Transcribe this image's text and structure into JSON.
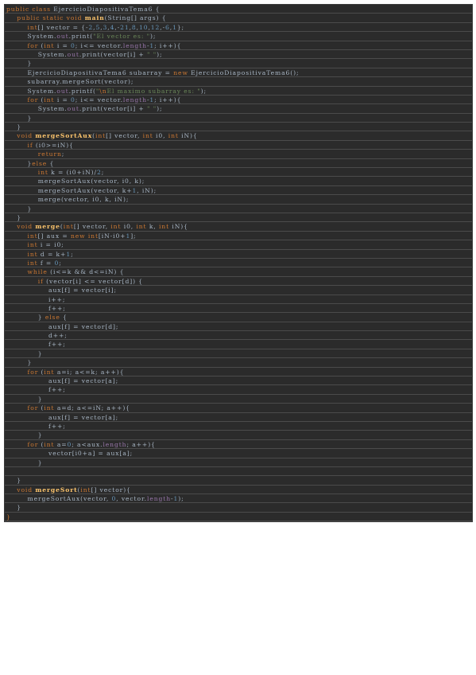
{
  "document": {
    "language": "java",
    "colors": {
      "background": "#2b2b2b",
      "keyword": "#cc7832",
      "method": "#ffc66d",
      "number": "#6897bb",
      "string": "#6a8759",
      "field": "#9876aa",
      "text": "#a9b7c6"
    },
    "lines": [
      [
        {
          "t": "kw",
          "v": "public class "
        },
        {
          "t": "tx",
          "v": "EjercicioDiapositivaTema6 {"
        }
      ],
      [
        {
          "t": "tx",
          "v": "    "
        },
        {
          "t": "kw",
          "v": "public static void "
        },
        {
          "t": "fn",
          "v": "main"
        },
        {
          "t": "tx",
          "v": "(String[] args) {"
        }
      ],
      [
        {
          "t": "tx",
          "v": "        "
        },
        {
          "t": "kw",
          "v": "int"
        },
        {
          "t": "tx",
          "v": "[] vector = {-"
        },
        {
          "t": "num",
          "v": "2"
        },
        {
          "t": "tx",
          "v": ","
        },
        {
          "t": "num",
          "v": "5"
        },
        {
          "t": "tx",
          "v": ","
        },
        {
          "t": "num",
          "v": "3"
        },
        {
          "t": "tx",
          "v": ","
        },
        {
          "t": "num",
          "v": "4"
        },
        {
          "t": "tx",
          "v": ",-"
        },
        {
          "t": "num",
          "v": "21"
        },
        {
          "t": "tx",
          "v": ","
        },
        {
          "t": "num",
          "v": "8"
        },
        {
          "t": "tx",
          "v": ","
        },
        {
          "t": "num",
          "v": "10"
        },
        {
          "t": "tx",
          "v": ","
        },
        {
          "t": "num",
          "v": "12"
        },
        {
          "t": "tx",
          "v": ",-"
        },
        {
          "t": "num",
          "v": "6"
        },
        {
          "t": "tx",
          "v": ","
        },
        {
          "t": "num",
          "v": "1"
        },
        {
          "t": "tx",
          "v": "};"
        }
      ],
      [
        {
          "t": "tx",
          "v": "        System."
        },
        {
          "t": "fld",
          "v": "out"
        },
        {
          "t": "tx",
          "v": ".print("
        },
        {
          "t": "str",
          "v": "\"El vector es: \""
        },
        {
          "t": "tx",
          "v": ");"
        }
      ],
      [
        {
          "t": "tx",
          "v": "        "
        },
        {
          "t": "kw",
          "v": "for "
        },
        {
          "t": "tx",
          "v": "("
        },
        {
          "t": "kw",
          "v": "int "
        },
        {
          "t": "tx",
          "v": "i = "
        },
        {
          "t": "num",
          "v": "0"
        },
        {
          "t": "tx",
          "v": "; i<= vector."
        },
        {
          "t": "fld",
          "v": "length"
        },
        {
          "t": "tx",
          "v": "-"
        },
        {
          "t": "num",
          "v": "1"
        },
        {
          "t": "tx",
          "v": "; i++){"
        }
      ],
      [
        {
          "t": "tx",
          "v": "            System."
        },
        {
          "t": "fld",
          "v": "out"
        },
        {
          "t": "tx",
          "v": ".print(vector[i] + "
        },
        {
          "t": "str",
          "v": "\" \""
        },
        {
          "t": "tx",
          "v": ");"
        }
      ],
      [
        {
          "t": "tx",
          "v": "        }"
        }
      ],
      [
        {
          "t": "tx",
          "v": "        EjercicioDiapositivaTema6 subarray = "
        },
        {
          "t": "kw",
          "v": "new "
        },
        {
          "t": "tx",
          "v": "EjercicioDiapositivaTema6();"
        }
      ],
      [
        {
          "t": "tx",
          "v": "        subarray.mergeSort(vector);"
        }
      ],
      [
        {
          "t": "tx",
          "v": "        System."
        },
        {
          "t": "fld",
          "v": "out"
        },
        {
          "t": "tx",
          "v": ".printf("
        },
        {
          "t": "str",
          "v": "\""
        },
        {
          "t": "esc",
          "v": "\\n"
        },
        {
          "t": "str",
          "v": "El maximo subarray es: \""
        },
        {
          "t": "tx",
          "v": ");"
        }
      ],
      [
        {
          "t": "tx",
          "v": "        "
        },
        {
          "t": "kw",
          "v": "for "
        },
        {
          "t": "tx",
          "v": "("
        },
        {
          "t": "kw",
          "v": "int "
        },
        {
          "t": "tx",
          "v": "i = "
        },
        {
          "t": "num",
          "v": "0"
        },
        {
          "t": "tx",
          "v": "; i<= vector."
        },
        {
          "t": "fld",
          "v": "length"
        },
        {
          "t": "tx",
          "v": "-"
        },
        {
          "t": "num",
          "v": "1"
        },
        {
          "t": "tx",
          "v": "; i++){"
        }
      ],
      [
        {
          "t": "tx",
          "v": "            System."
        },
        {
          "t": "fld",
          "v": "out"
        },
        {
          "t": "tx",
          "v": ".print(vector[i] + "
        },
        {
          "t": "str",
          "v": "\" \""
        },
        {
          "t": "tx",
          "v": ");"
        }
      ],
      [
        {
          "t": "tx",
          "v": "        }"
        }
      ],
      [
        {
          "t": "tx",
          "v": "    }"
        }
      ],
      [
        {
          "t": "tx",
          "v": "    "
        },
        {
          "t": "kw",
          "v": "void "
        },
        {
          "t": "fn",
          "v": "mergeSortAux"
        },
        {
          "t": "tx",
          "v": "("
        },
        {
          "t": "kw",
          "v": "int"
        },
        {
          "t": "tx",
          "v": "[] vector, "
        },
        {
          "t": "kw",
          "v": "int "
        },
        {
          "t": "tx",
          "v": "i0, "
        },
        {
          "t": "kw",
          "v": "int "
        },
        {
          "t": "tx",
          "v": "iN){"
        }
      ],
      [
        {
          "t": "tx",
          "v": "        "
        },
        {
          "t": "kw",
          "v": "if "
        },
        {
          "t": "tx",
          "v": "(i0>=iN){"
        }
      ],
      [
        {
          "t": "tx",
          "v": "            "
        },
        {
          "t": "kw",
          "v": "return"
        },
        {
          "t": "tx",
          "v": ";"
        }
      ],
      [
        {
          "t": "tx",
          "v": "        }"
        },
        {
          "t": "kw",
          "v": "else "
        },
        {
          "t": "tx",
          "v": "{"
        }
      ],
      [
        {
          "t": "tx",
          "v": "            "
        },
        {
          "t": "kw",
          "v": "int "
        },
        {
          "t": "tx",
          "v": "k = (i0+iN)/"
        },
        {
          "t": "num",
          "v": "2"
        },
        {
          "t": "tx",
          "v": ";"
        }
      ],
      [
        {
          "t": "tx",
          "v": "            mergeSortAux(vector, i0, k);"
        }
      ],
      [
        {
          "t": "tx",
          "v": "            mergeSortAux(vector, k+"
        },
        {
          "t": "num",
          "v": "1"
        },
        {
          "t": "tx",
          "v": ", iN);"
        }
      ],
      [
        {
          "t": "tx",
          "v": "            merge(vector, i0, k, iN);"
        }
      ],
      [
        {
          "t": "tx",
          "v": "        }"
        }
      ],
      [
        {
          "t": "tx",
          "v": "    }"
        }
      ],
      [
        {
          "t": "tx",
          "v": "    "
        },
        {
          "t": "kw",
          "v": "void "
        },
        {
          "t": "fn",
          "v": "merge"
        },
        {
          "t": "tx",
          "v": "("
        },
        {
          "t": "kw",
          "v": "int"
        },
        {
          "t": "tx",
          "v": "[] vector, "
        },
        {
          "t": "kw",
          "v": "int "
        },
        {
          "t": "tx",
          "v": "i0, "
        },
        {
          "t": "kw",
          "v": "int "
        },
        {
          "t": "tx",
          "v": "k, "
        },
        {
          "t": "kw",
          "v": "int "
        },
        {
          "t": "tx",
          "v": "iN){"
        }
      ],
      [
        {
          "t": "tx",
          "v": "        "
        },
        {
          "t": "kw",
          "v": "int"
        },
        {
          "t": "tx",
          "v": "[] aux = "
        },
        {
          "t": "kw",
          "v": "new int"
        },
        {
          "t": "tx",
          "v": "[iN-i0+"
        },
        {
          "t": "num",
          "v": "1"
        },
        {
          "t": "tx",
          "v": "];"
        }
      ],
      [
        {
          "t": "tx",
          "v": "        "
        },
        {
          "t": "kw",
          "v": "int "
        },
        {
          "t": "tx",
          "v": "i = i0;"
        }
      ],
      [
        {
          "t": "tx",
          "v": "        "
        },
        {
          "t": "kw",
          "v": "int "
        },
        {
          "t": "tx",
          "v": "d = k+"
        },
        {
          "t": "num",
          "v": "1"
        },
        {
          "t": "tx",
          "v": ";"
        }
      ],
      [
        {
          "t": "tx",
          "v": "        "
        },
        {
          "t": "kw",
          "v": "int "
        },
        {
          "t": "tx",
          "v": "f = "
        },
        {
          "t": "num",
          "v": "0"
        },
        {
          "t": "tx",
          "v": ";"
        }
      ],
      [
        {
          "t": "tx",
          "v": "        "
        },
        {
          "t": "kw",
          "v": "while "
        },
        {
          "t": "tx",
          "v": "(i<=k && d<=iN) {"
        }
      ],
      [
        {
          "t": "tx",
          "v": "            "
        },
        {
          "t": "kw",
          "v": "if "
        },
        {
          "t": "tx",
          "v": "(vector[i] <= vector[d]) {"
        }
      ],
      [
        {
          "t": "tx",
          "v": "                aux[f] = vector[i];"
        }
      ],
      [
        {
          "t": "tx",
          "v": "                i++;"
        }
      ],
      [
        {
          "t": "tx",
          "v": "                f++;"
        }
      ],
      [
        {
          "t": "tx",
          "v": "            } "
        },
        {
          "t": "kw",
          "v": "else "
        },
        {
          "t": "tx",
          "v": "{"
        }
      ],
      [
        {
          "t": "tx",
          "v": "                aux[f] = vector[d];"
        }
      ],
      [
        {
          "t": "tx",
          "v": "                d++;"
        }
      ],
      [
        {
          "t": "tx",
          "v": "                f++;"
        }
      ],
      [
        {
          "t": "tx",
          "v": "            }"
        }
      ],
      [
        {
          "t": "tx",
          "v": "        }"
        }
      ],
      [
        {
          "t": "tx",
          "v": "        "
        },
        {
          "t": "kw",
          "v": "for "
        },
        {
          "t": "tx",
          "v": "("
        },
        {
          "t": "kw",
          "v": "int "
        },
        {
          "t": "tx",
          "v": "a=i; a<=k; a++){"
        }
      ],
      [
        {
          "t": "tx",
          "v": "                aux[f] = vector[a];"
        }
      ],
      [
        {
          "t": "tx",
          "v": "                f++;"
        }
      ],
      [
        {
          "t": "tx",
          "v": "            }"
        }
      ],
      [
        {
          "t": "tx",
          "v": "        "
        },
        {
          "t": "kw",
          "v": "for "
        },
        {
          "t": "tx",
          "v": "("
        },
        {
          "t": "kw",
          "v": "int "
        },
        {
          "t": "tx",
          "v": "a=d; a<=iN; a++){"
        }
      ],
      [
        {
          "t": "tx",
          "v": "                aux[f] = vector[a];"
        }
      ],
      [
        {
          "t": "tx",
          "v": "                f++;"
        }
      ],
      [
        {
          "t": "tx",
          "v": "            }"
        }
      ],
      [
        {
          "t": "tx",
          "v": "        "
        },
        {
          "t": "kw",
          "v": "for "
        },
        {
          "t": "tx",
          "v": "("
        },
        {
          "t": "kw",
          "v": "int "
        },
        {
          "t": "tx",
          "v": "a="
        },
        {
          "t": "num",
          "v": "0"
        },
        {
          "t": "tx",
          "v": "; a<aux."
        },
        {
          "t": "fld",
          "v": "length"
        },
        {
          "t": "tx",
          "v": "; a++){"
        }
      ],
      [
        {
          "t": "tx",
          "v": "                vector[i0+a] = aux[a];"
        }
      ],
      [
        {
          "t": "tx",
          "v": "            }"
        }
      ],
      [
        {
          "t": "tx",
          "v": ""
        }
      ],
      [
        {
          "t": "tx",
          "v": "    }"
        }
      ],
      [
        {
          "t": "tx",
          "v": "    "
        },
        {
          "t": "kw",
          "v": "void "
        },
        {
          "t": "fn",
          "v": "mergeSort"
        },
        {
          "t": "tx",
          "v": "("
        },
        {
          "t": "kw",
          "v": "int"
        },
        {
          "t": "tx",
          "v": "[] vector){"
        }
      ],
      [
        {
          "t": "tx",
          "v": "        mergeSortAux(vector, "
        },
        {
          "t": "num",
          "v": "0"
        },
        {
          "t": "tx",
          "v": ", vector."
        },
        {
          "t": "fld",
          "v": "length"
        },
        {
          "t": "tx",
          "v": "-"
        },
        {
          "t": "num",
          "v": "1"
        },
        {
          "t": "tx",
          "v": ");"
        }
      ],
      [
        {
          "t": "tx",
          "v": "    }"
        }
      ],
      [
        {
          "t": "kw",
          "v": "}"
        }
      ]
    ]
  }
}
